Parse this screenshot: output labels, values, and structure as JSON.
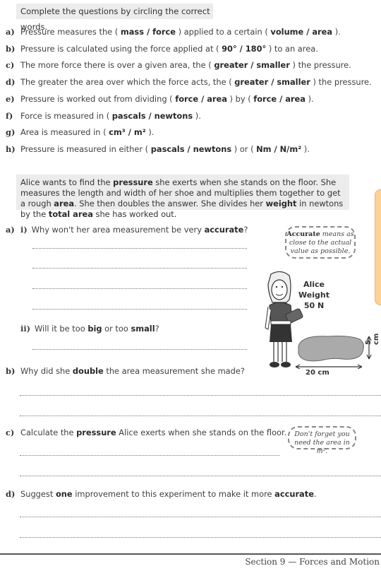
{
  "instruction": "Complete the questions by circling the correct words.",
  "circle_questions": [
    {
      "label": "a)",
      "parts": [
        "Pressure measures the ( ",
        "mass / force",
        " ) applied to a certain ( ",
        "volume / area",
        " )."
      ]
    },
    {
      "label": "b)",
      "parts": [
        "Pressure is calculated using the force applied at ( ",
        "90° / 180°",
        " ) to an area."
      ]
    },
    {
      "label": "c)",
      "parts": [
        "The more force there is over a given area, the ( ",
        "greater / smaller",
        " ) the pressure."
      ]
    },
    {
      "label": "d)",
      "parts": [
        "The greater the area over which the force acts, the ( ",
        "greater / smaller",
        " ) the pressure."
      ]
    },
    {
      "label": "e)",
      "parts": [
        "Pressure is worked out from dividing ( ",
        "force / area",
        " ) by ( ",
        "force / area",
        " )."
      ]
    },
    {
      "label": "f)",
      "parts": [
        "Force is measured in ( ",
        "pascals / newtons",
        " )."
      ]
    },
    {
      "label": "g)",
      "parts": [
        "Area is measured in ( ",
        "cm³ / m²",
        " )."
      ]
    },
    {
      "label": "h)",
      "parts": [
        "Pressure is measured in either ( ",
        "pascals / newtons",
        " ) or ( ",
        "Nm / N/m²",
        " )."
      ]
    }
  ],
  "scenario": {
    "parts": [
      "Alice wants to find the ",
      "pressure",
      " she exerts when she stands on the floor.  She measures the length and width of her shoe and multiplies them together to get a rough ",
      "area",
      ".  She then doubles the answer.  She divides her ",
      "weight",
      " in newtons by the ",
      "total area",
      " she has worked out."
    ]
  },
  "questions": {
    "a_label": "a)",
    "a_i_label": "i)",
    "a_i_parts": [
      "Why won't her area measurement be very ",
      "accurate",
      "?"
    ],
    "a_ii_label": "ii)",
    "a_ii_parts": [
      "Will it be too ",
      "big",
      " or too ",
      "small",
      "?"
    ],
    "b_label": "b)",
    "b_parts": [
      "Why did she ",
      "double",
      " the area measurement she made?"
    ],
    "c_label": "c)",
    "c_parts": [
      "Calculate the ",
      "pressure",
      " Alice exerts when she stands on the floor."
    ],
    "d_label": "d)",
    "d_parts": [
      "Suggest ",
      "one",
      " improvement to this experiment to make it more ",
      "accurate",
      "."
    ]
  },
  "tips": {
    "accurate_bold": "Accurate",
    "accurate_rest": " means as close to the actual value as possible.",
    "area_hint": "Don't forget you need the area in m²."
  },
  "figure": {
    "name": "Alice",
    "weight": "Weight 50 N",
    "shoe_length": "20 cm",
    "shoe_width": "5 cm"
  },
  "footer": "Section 9 — Forces and Motion"
}
